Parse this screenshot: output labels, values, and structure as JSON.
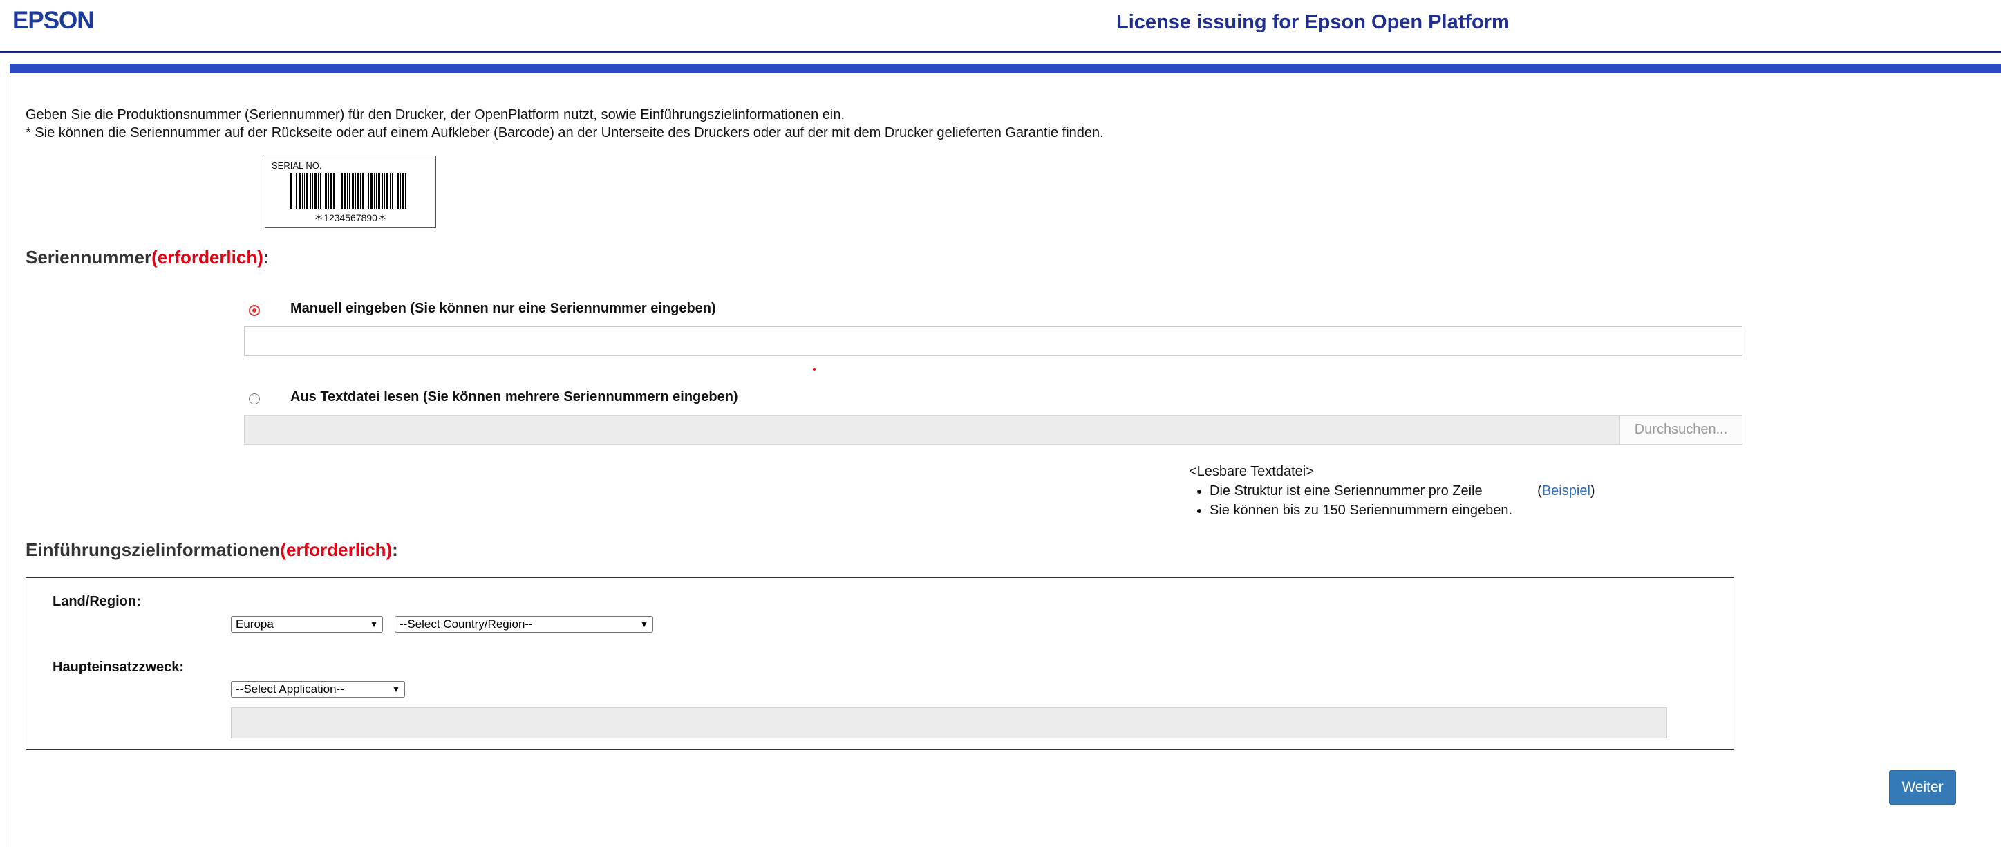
{
  "header": {
    "logo": "EPSON",
    "title": "License issuing for Epson Open Platform"
  },
  "intro": {
    "line1": "Geben Sie die Produktionsnummer (Seriennummer) für den Drucker, der OpenPlatform nutzt, sowie Einführungszielinformationen ein.",
    "line2": "* Sie können die Seriennummer auf der Rückseite oder auf einem Aufkleber (Barcode) an der Unterseite des Druckers oder auf der mit dem Drucker gelieferten Garantie finden."
  },
  "barcode": {
    "label": "SERIAL NO.",
    "number": "＊1234567890＊"
  },
  "serial_section": {
    "title": "Seriennummer",
    "required": "(erforderlich)",
    "colon": ":",
    "manual_label": "Manuell eingeben (Sie können nur eine Seriennummer eingeben)",
    "manual_value": "",
    "file_label": "Aus Textdatei lesen (Sie können mehrere Seriennummern eingeben)",
    "browse_label": "Durchsuchen...",
    "selected": "manual"
  },
  "readable_file": {
    "heading": "<Lesbare Textdatei>",
    "item1": "Die Struktur ist eine Seriennummer pro Zeile",
    "example_open": "(",
    "example_link": "Beispiel",
    "example_close": ")",
    "item2": "Sie können bis zu 150 Seriennummern eingeben."
  },
  "target_section": {
    "title": "Einführungszielinformationen",
    "required": "(erforderlich)",
    "colon": ":",
    "region_label": "Land/Region:",
    "region_value": "Europa",
    "country_value": "--Select Country/Region--",
    "purpose_label": "Haupteinsatzzweck:",
    "application_value": "--Select Application--"
  },
  "actions": {
    "next_label": "Weiter"
  },
  "colors": {
    "brand_blue": "#1a3a9c",
    "bar_blue": "#2d4ac6",
    "required_red": "#e60012",
    "button_blue": "#337ab7"
  }
}
